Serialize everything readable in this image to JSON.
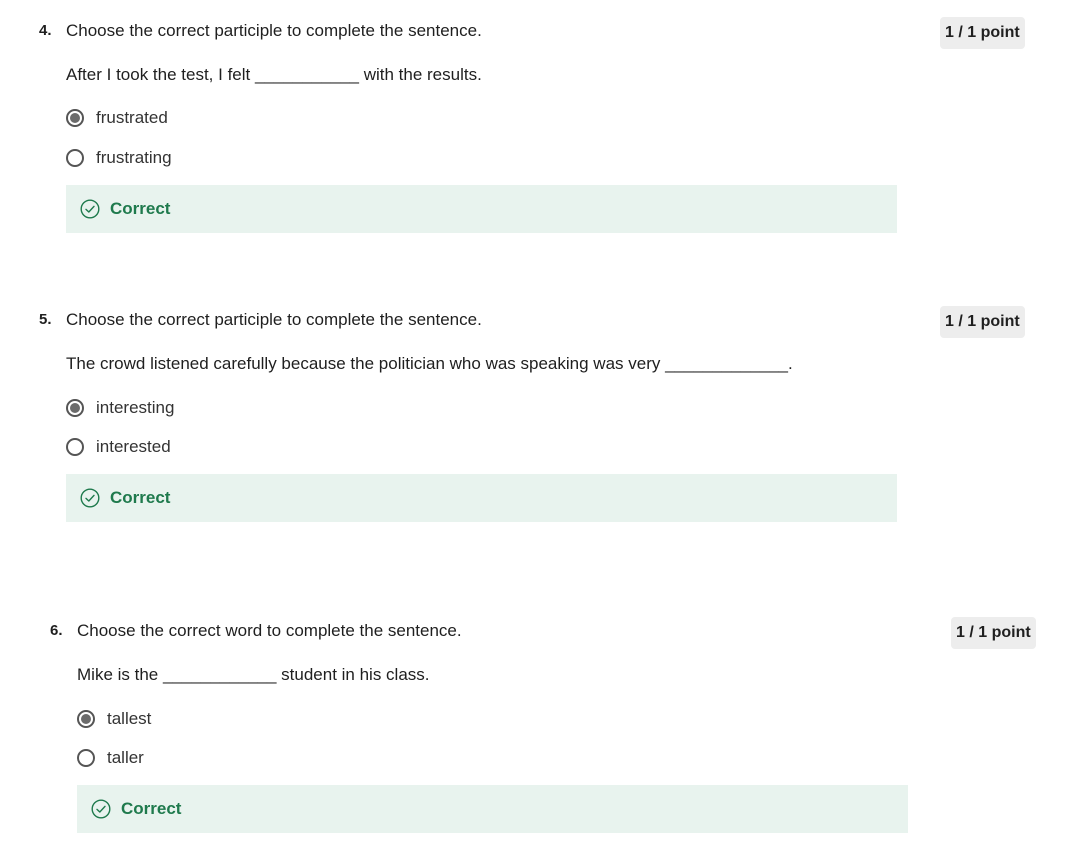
{
  "questions": [
    {
      "number": "4.",
      "prompt": "Choose the correct participle to complete the sentence.",
      "sentence": "After I took the test, I felt ___________ with the results.",
      "points": "1 / 1 point",
      "options": [
        {
          "label": "frustrated",
          "selected": true
        },
        {
          "label": "frustrating",
          "selected": false
        }
      ],
      "feedback": "Correct"
    },
    {
      "number": "5.",
      "prompt": "Choose the correct participle to complete the sentence.",
      "sentence": "The crowd listened carefully because the politician who was speaking was very _____________.",
      "points": "1 / 1 point",
      "options": [
        {
          "label": "interesting",
          "selected": true
        },
        {
          "label": "interested",
          "selected": false
        }
      ],
      "feedback": "Correct"
    },
    {
      "number": "6.",
      "prompt": "Choose the correct word to complete the sentence.",
      "sentence": "Mike is the ____________ student in his class.",
      "points": "1 / 1 point",
      "options": [
        {
          "label": "tallest",
          "selected": true
        },
        {
          "label": "taller",
          "selected": false
        }
      ],
      "feedback": "Correct"
    }
  ],
  "colors": {
    "correct_bg": "#e8f3ee",
    "correct_text": "#1f7a4d",
    "badge_bg": "#ededed"
  },
  "icons": {
    "feedback": "check-circle-icon"
  }
}
